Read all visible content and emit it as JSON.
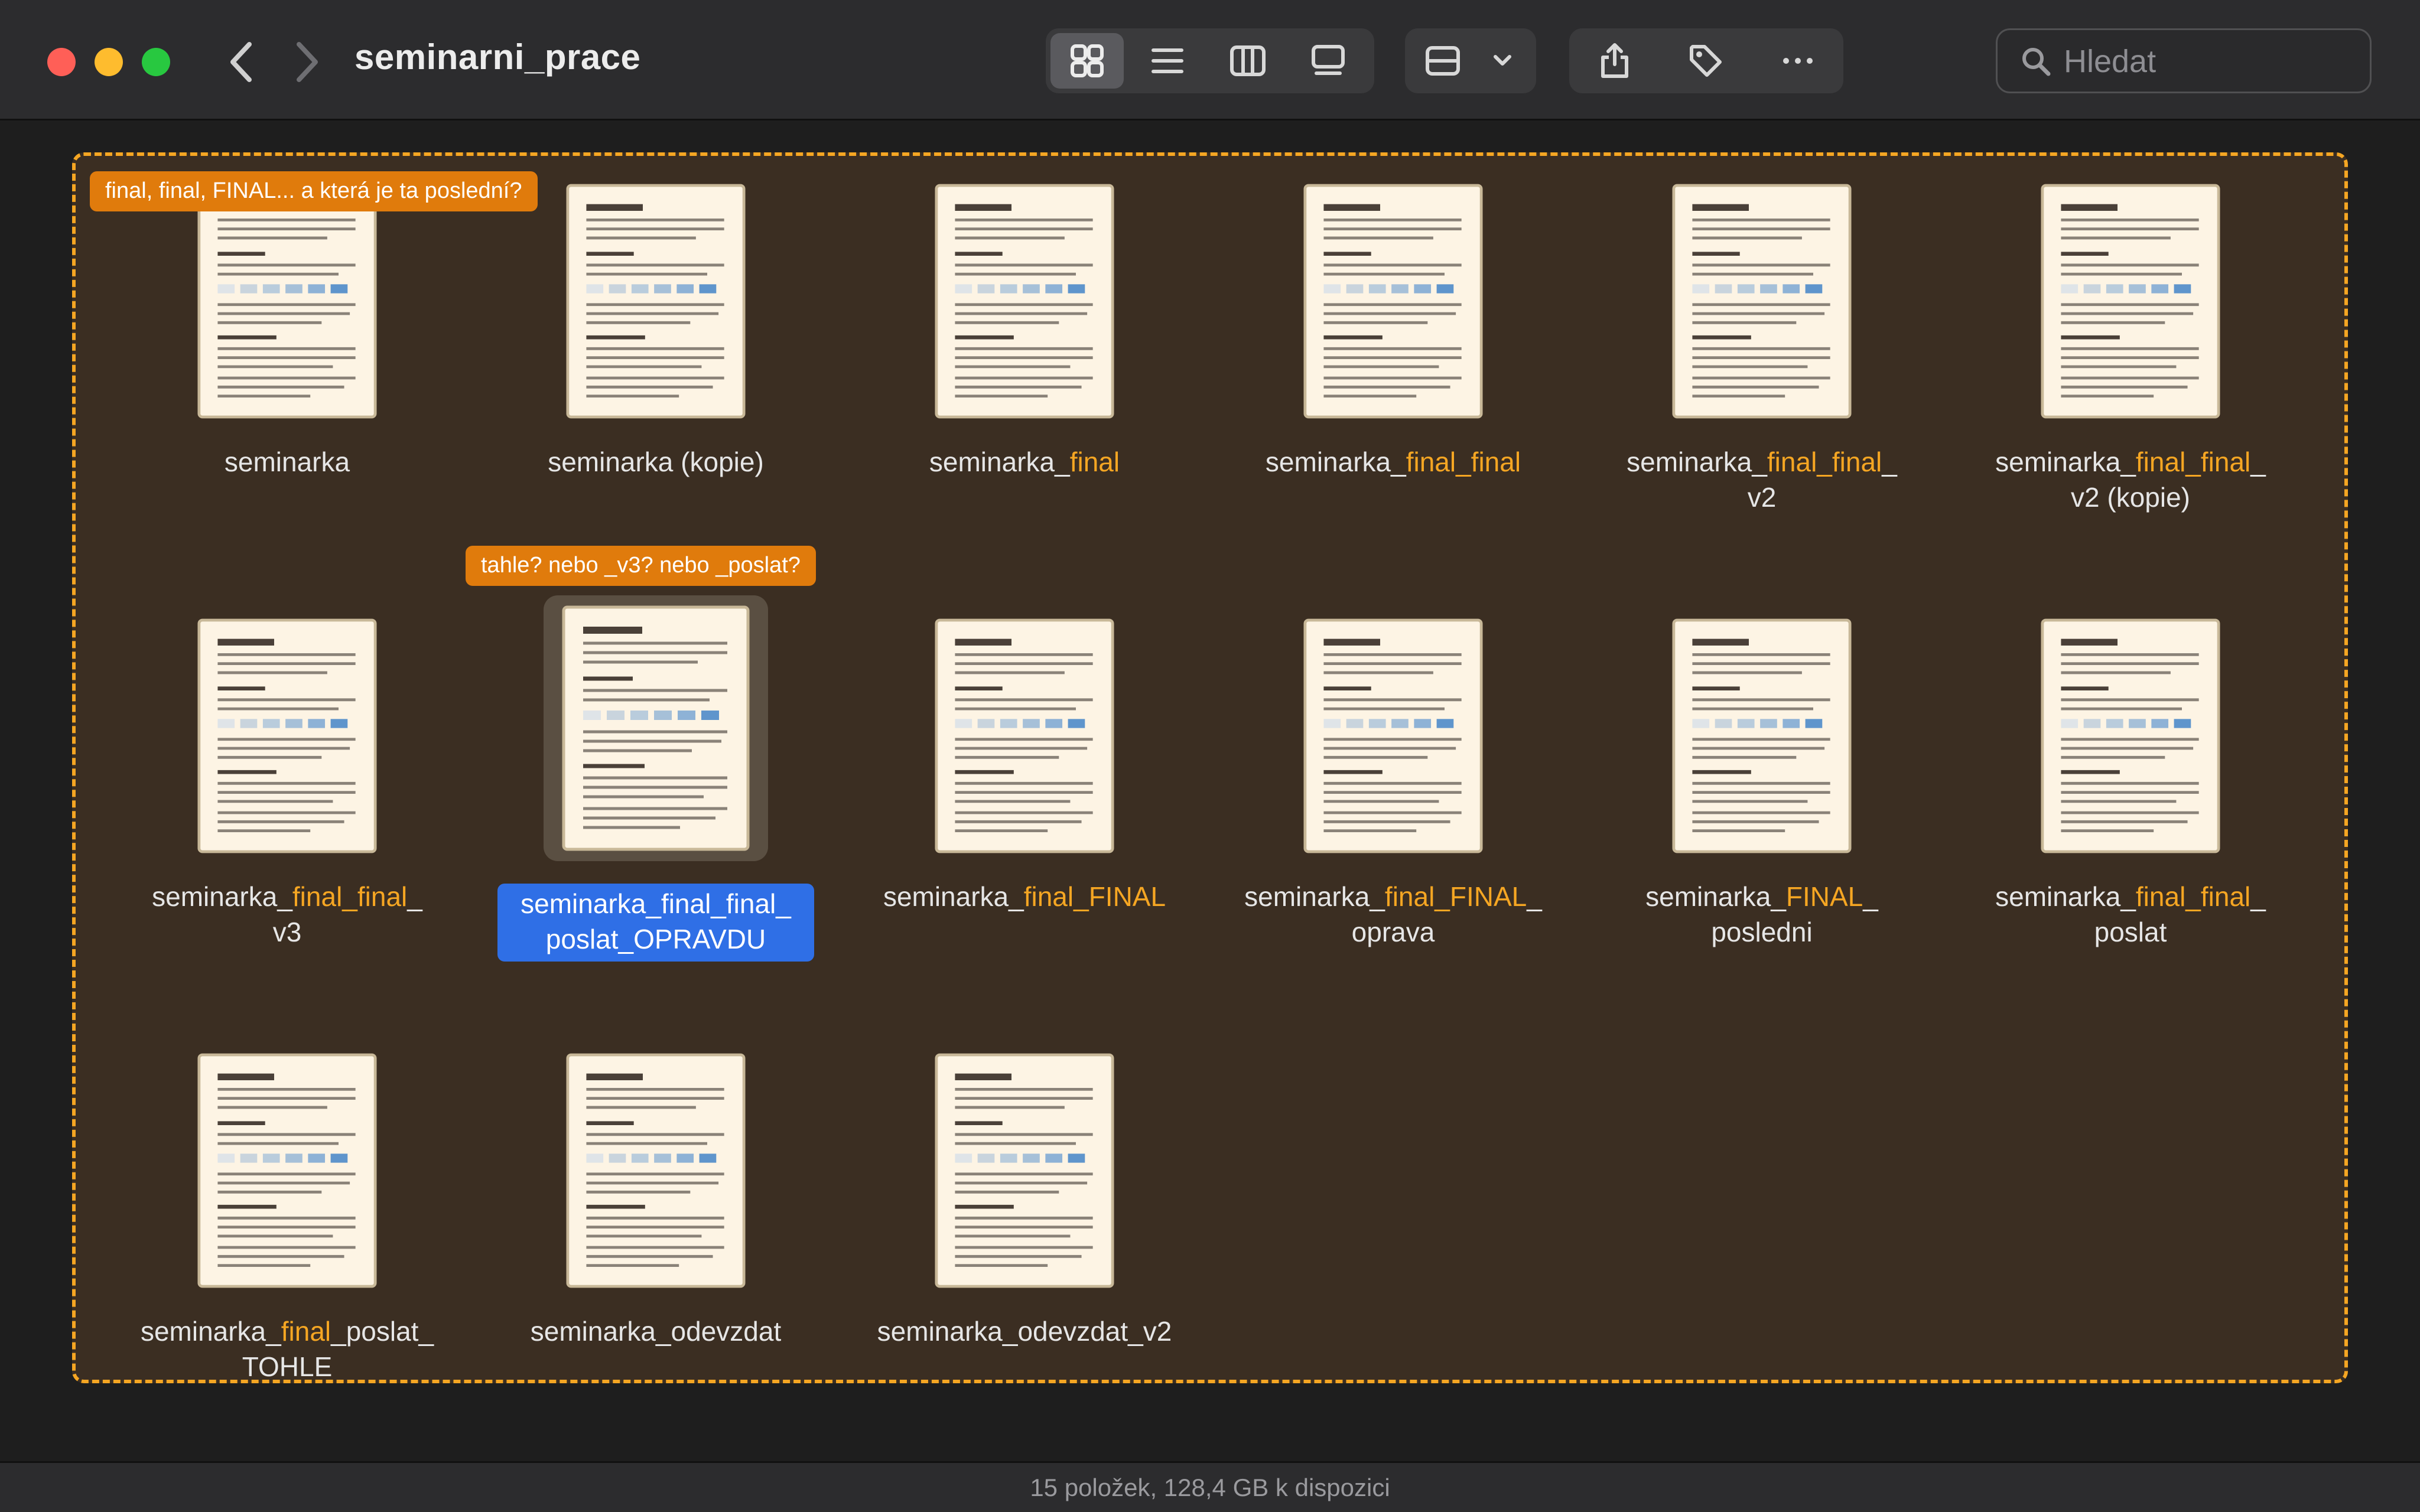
{
  "window": {
    "title": "seminarni_prace",
    "traffic_lights": [
      "close",
      "minimize",
      "zoom"
    ]
  },
  "toolbar": {
    "nav": [
      "chevron-left-icon",
      "chevron-right-icon"
    ],
    "view_modes": [
      {
        "name": "icon-view",
        "icon": "grid-icon",
        "active": true
      },
      {
        "name": "list-view",
        "icon": "list-icon",
        "active": false
      },
      {
        "name": "column-view",
        "icon": "columns-icon",
        "active": false
      },
      {
        "name": "gallery-view",
        "icon": "gallery-icon",
        "active": false
      }
    ],
    "group_menu": {
      "icon": "group-icon",
      "chevron": "chevron-down-icon"
    },
    "actions": [
      "share-icon",
      "tag-icon",
      "more-icon"
    ]
  },
  "search": {
    "placeholder": "Hledat",
    "value": ""
  },
  "annotations": {
    "top_note": "final, final, FINAL... a která je ta poslední?",
    "selected_note": "tahle? nebo _v3? nebo _poslat?"
  },
  "files": [
    {
      "id": 0,
      "parts": [
        [
          "seminarka",
          false
        ]
      ]
    },
    {
      "id": 1,
      "parts": [
        [
          "seminarka (kopie)",
          false
        ]
      ]
    },
    {
      "id": 2,
      "parts": [
        [
          "seminarka_",
          false
        ],
        [
          "final",
          true
        ]
      ]
    },
    {
      "id": 3,
      "parts": [
        [
          "seminarka_",
          false
        ],
        [
          "final_final",
          true
        ]
      ]
    },
    {
      "id": 4,
      "parts": [
        [
          "seminarka_",
          false
        ],
        [
          "final_final",
          true
        ],
        [
          "_",
          false
        ],
        [
          "\n",
          false
        ],
        [
          "v2",
          false
        ]
      ]
    },
    {
      "id": 5,
      "parts": [
        [
          "seminarka_",
          false
        ],
        [
          "final_final",
          true
        ],
        [
          "_",
          false
        ],
        [
          "\n",
          false
        ],
        [
          "v2 (kopie)",
          false
        ]
      ]
    },
    {
      "id": 6,
      "parts": [
        [
          "seminarka_",
          false
        ],
        [
          "final_final",
          true
        ],
        [
          "_",
          false
        ],
        [
          "\n",
          false
        ],
        [
          "v3",
          false
        ]
      ]
    },
    {
      "id": 7,
      "selected": true,
      "parts": [
        [
          "seminarka_final_final_",
          false
        ],
        [
          "\n",
          false
        ],
        [
          "poslat_OPRAVDU",
          false
        ]
      ]
    },
    {
      "id": 8,
      "parts": [
        [
          "seminarka_",
          false
        ],
        [
          "final_FINAL",
          true
        ]
      ]
    },
    {
      "id": 9,
      "parts": [
        [
          "seminarka_",
          false
        ],
        [
          "final_FINAL",
          true
        ],
        [
          "_",
          false
        ],
        [
          "\n",
          false
        ],
        [
          "oprava",
          false
        ]
      ]
    },
    {
      "id": 10,
      "parts": [
        [
          "seminarka_",
          false
        ],
        [
          "FINAL",
          true
        ],
        [
          "_",
          false
        ],
        [
          "\n",
          false
        ],
        [
          "posledni",
          false
        ]
      ]
    },
    {
      "id": 11,
      "parts": [
        [
          "seminarka_",
          false
        ],
        [
          "final_final",
          true
        ],
        [
          "_",
          false
        ],
        [
          "\n",
          false
        ],
        [
          "poslat",
          false
        ]
      ]
    },
    {
      "id": 12,
      "parts": [
        [
          "seminarka_",
          false
        ],
        [
          "final",
          true
        ],
        [
          "_poslat_",
          false
        ],
        [
          "\n",
          false
        ],
        [
          "TOHLE",
          false
        ]
      ]
    },
    {
      "id": 13,
      "parts": [
        [
          "seminarka_odevzdat",
          false
        ]
      ]
    },
    {
      "id": 14,
      "parts": [
        [
          "seminarka_odevzdat_v2",
          false
        ]
      ]
    }
  ],
  "status": {
    "text": "15 položek, 128,4 GB k dispozici"
  },
  "colors": {
    "accent_orange": "#f5a623",
    "note_orange": "#e07b0c",
    "selection_blue": "#2f6fe6",
    "folder_bg": "#3b2e22"
  }
}
